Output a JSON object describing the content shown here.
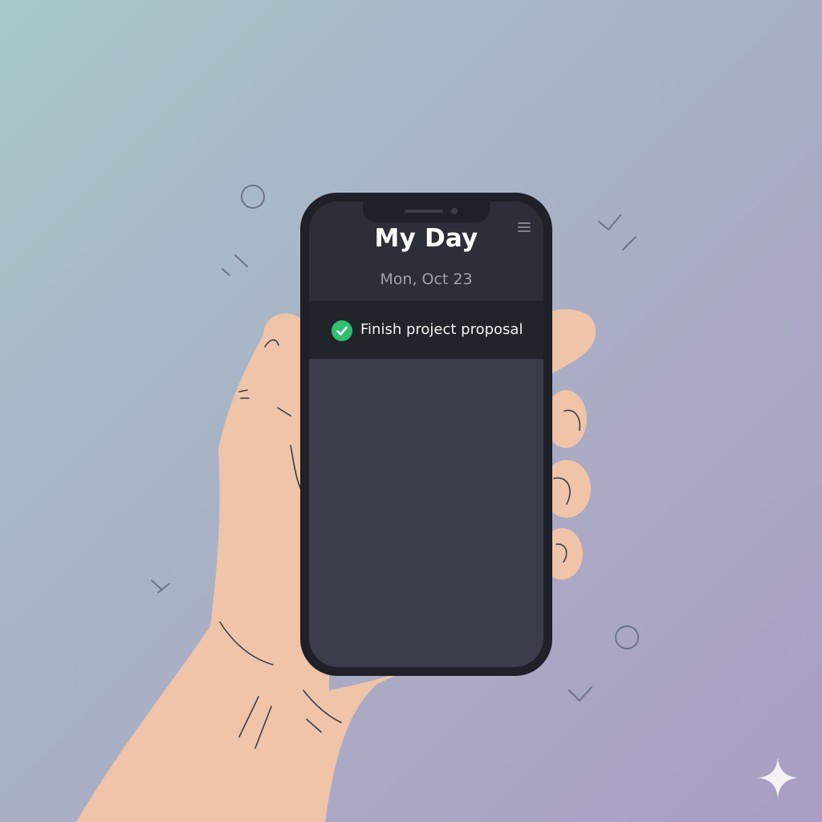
{
  "app": {
    "title": "My Day",
    "date": "Mon, Oct 23"
  },
  "tasks": [
    {
      "label": "Finish project proposal",
      "completed": true
    }
  ],
  "icons": {
    "menu": "menu-icon",
    "task_status": "check-circle-icon",
    "sparkle": "sparkle-icon"
  },
  "colors": {
    "check": "#2fbf71",
    "screen": "#3a3d4a",
    "header": "#2c2e38",
    "task_row": "#22242c",
    "skin": "#efc4a9"
  }
}
